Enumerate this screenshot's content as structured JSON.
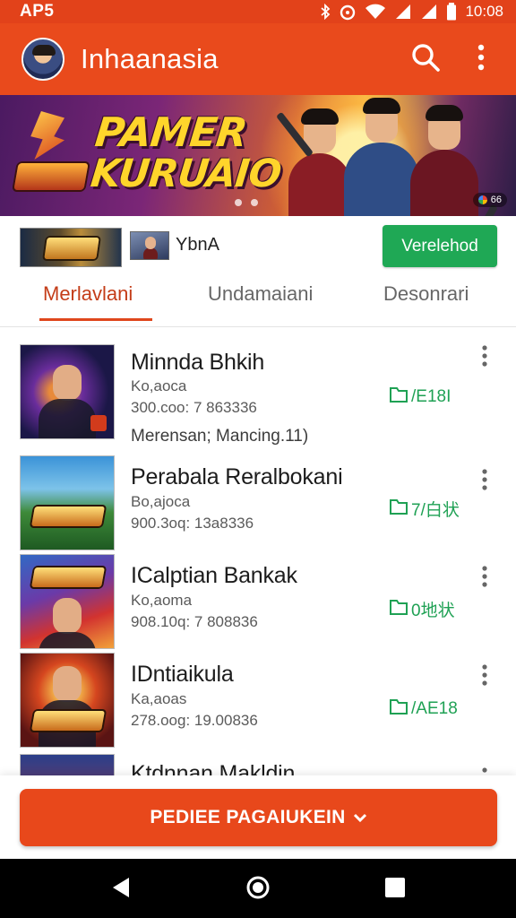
{
  "status_bar": {
    "left_text": "AP5",
    "time": "10:08"
  },
  "app_bar": {
    "title": "Inhaanasia"
  },
  "banner": {
    "headline_line1": "PAMER",
    "headline_line2": "KURUAIO",
    "badge_text": "66"
  },
  "promo": {
    "label": "YbnA",
    "button_label": "Verelehod"
  },
  "tabs": [
    {
      "label": "Merlavlani",
      "active": true
    },
    {
      "label": "Undamaiani",
      "active": false
    },
    {
      "label": "Desonrari",
      "active": false
    }
  ],
  "items": [
    {
      "title": "Minnda Bhkih",
      "meta1": "Ko,aoca",
      "meta2": "300.coo: 7 863336",
      "extra": "Merensan; Mancing.11)",
      "stat": "/E18I",
      "icon": "folder-icon"
    },
    {
      "title": "Perabala Reralbokani",
      "meta1": "Bo,ajoca",
      "meta2": "900.3oq: 13a8336",
      "extra": "",
      "stat": "7/白状",
      "icon": "folder-icon"
    },
    {
      "title": "ICalptian Bankak",
      "meta1": "Ko,aoma",
      "meta2": "908.10q: 7 808836",
      "extra": "",
      "stat": "0地状",
      "icon": "folder-icon"
    },
    {
      "title": "IDntiaikula",
      "meta1": "Ka,aoas",
      "meta2": "278.oog: 19.00836",
      "extra": "",
      "stat": "/AE18",
      "icon": "folder-icon"
    },
    {
      "title": "Ktdnnan Makldin",
      "meta1": "",
      "meta2": "",
      "extra": "",
      "stat": "",
      "icon": "folder-icon"
    }
  ],
  "cta": {
    "label": "PEDIEE PAGAIUKEIN"
  },
  "colors": {
    "primary": "#e94a1c",
    "accent_green": "#1fa855",
    "tab_active": "#c43d19"
  }
}
